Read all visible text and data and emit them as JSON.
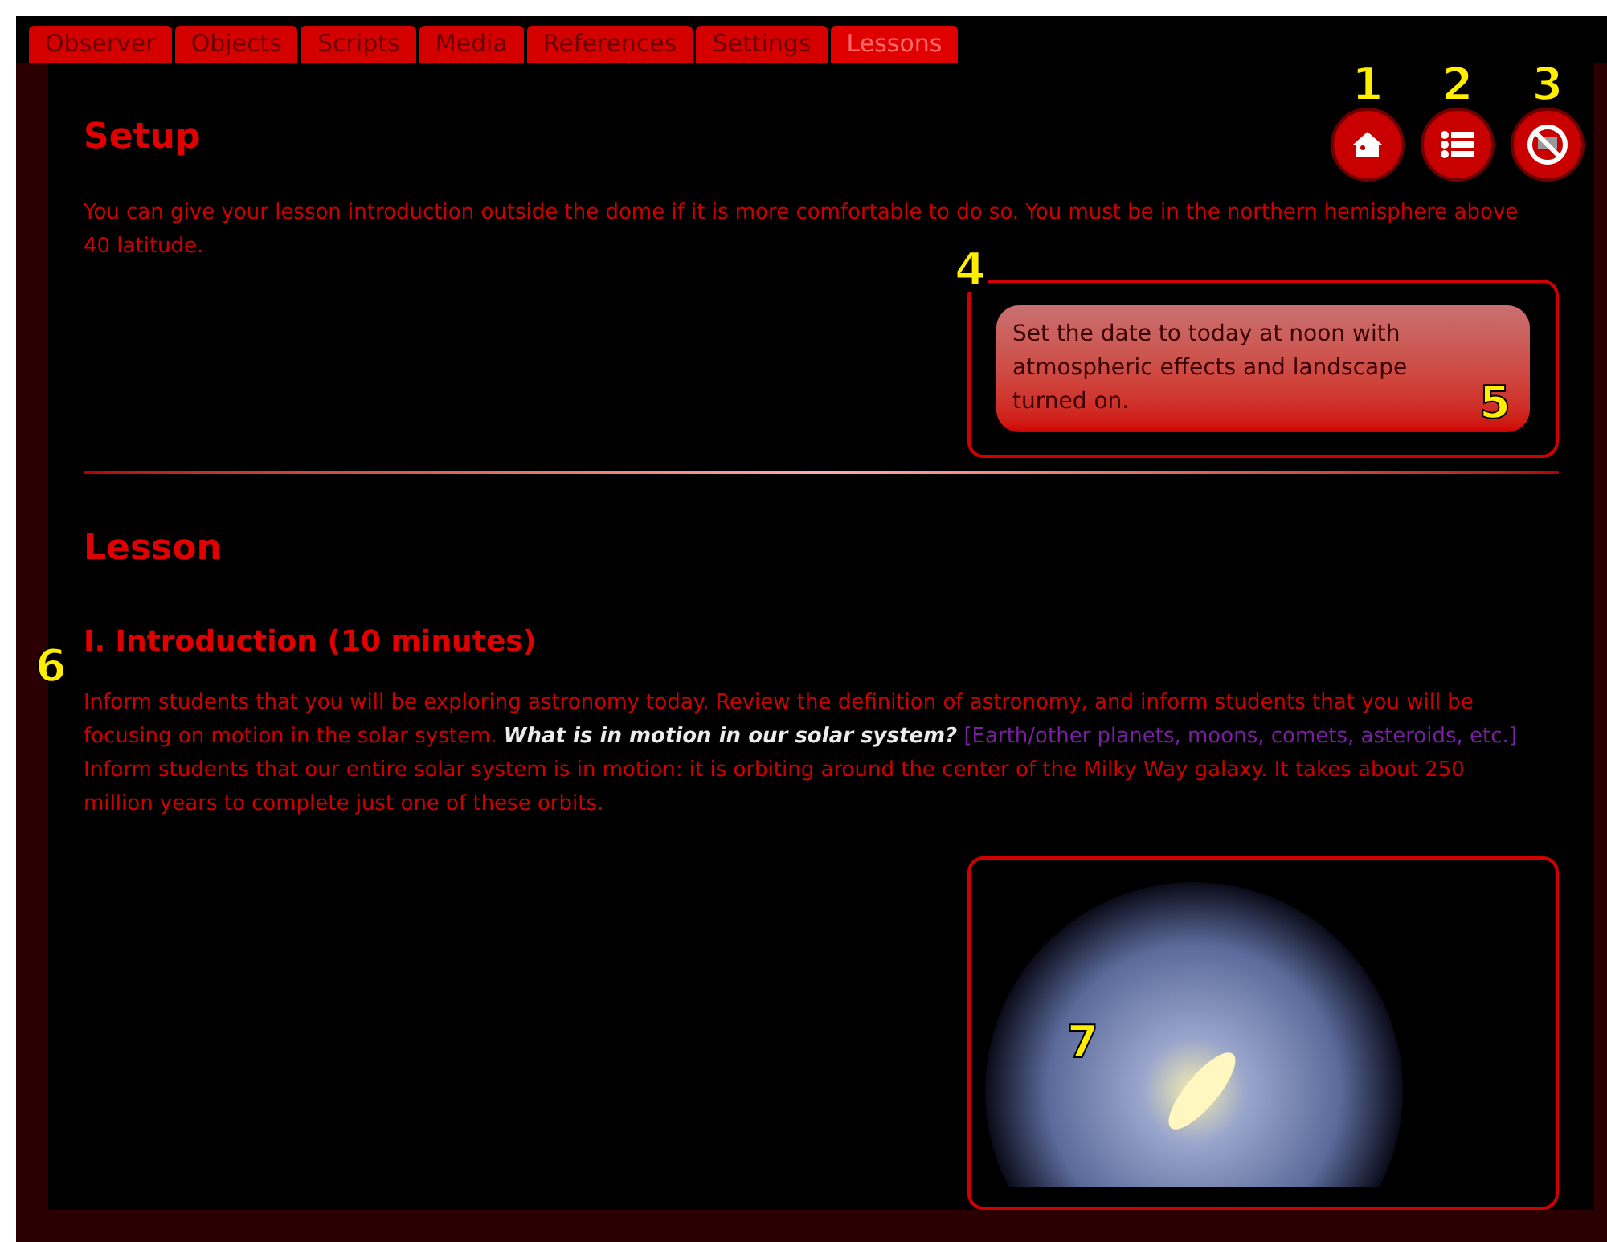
{
  "tabs": [
    {
      "label": "Observer",
      "selected": false
    },
    {
      "label": "Objects",
      "selected": false
    },
    {
      "label": "Scripts",
      "selected": false
    },
    {
      "label": "Media",
      "selected": false
    },
    {
      "label": "References",
      "selected": false
    },
    {
      "label": "Settings",
      "selected": false
    },
    {
      "label": "Lessons",
      "selected": true
    }
  ],
  "toolbar": [
    {
      "kind": "home",
      "callout": "1"
    },
    {
      "kind": "list",
      "callout": "2"
    },
    {
      "kind": "hide",
      "callout": "3"
    }
  ],
  "setup": {
    "heading": "Setup",
    "text": "You can give your lesson introduction outside the dome if it is more comfortable to do so. You must be in the northern hemisphere above 40 latitude.",
    "note": {
      "callout": "4",
      "text": "Set the date to today at noon with atmospheric effects and landscape turned on.",
      "button_callout": "5"
    }
  },
  "lesson": {
    "heading": "Lesson",
    "subheading": "I. Introduction (10 minutes)",
    "callout": "6",
    "paragraph": [
      {
        "kind": "normal",
        "text": "Inform students that you will be exploring astronomy today. Review the definition of astronomy, and inform students that you will be focusing on motion in the solar system. "
      },
      {
        "kind": "question",
        "text": "What is in motion in our solar system?"
      },
      {
        "kind": "answer",
        "text": " [Earth/other planets, moons, comets, asteroids, etc.]"
      },
      {
        "kind": "normal",
        "text": " Inform students that our entire solar system is in motion: it is orbiting around the center of the Milky Way galaxy. It takes about 250 million years to complete just one of these orbits."
      }
    ],
    "image": {
      "callout": "7"
    }
  }
}
